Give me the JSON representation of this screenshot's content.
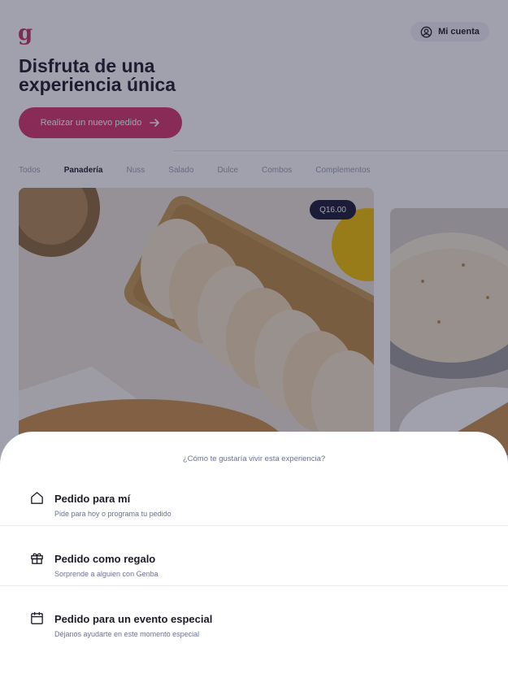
{
  "header": {
    "logo": "g",
    "account_label": "Mi cuenta"
  },
  "hero": {
    "title": "Disfruta de una experiencia única",
    "cta_label": "Realizar un nuevo pedido"
  },
  "tabs": [
    "Todos",
    "Panadería",
    "Nuss",
    "Salado",
    "Dulce",
    "Combos",
    "Complementos"
  ],
  "active_tab": "Panadería",
  "product": {
    "price": "Q16.00"
  },
  "sheet": {
    "title": "¿Cómo te gustaría vivir esta experiencia?",
    "options": [
      {
        "icon": "home-icon",
        "title": "Pedido para mí",
        "subtitle": "Pide para hoy o programa tu pedido"
      },
      {
        "icon": "gift-icon",
        "title": "Pedido como regalo",
        "subtitle": "Sorprende a alguien con Genba"
      },
      {
        "icon": "calendar-icon",
        "title": "Pedido para un evento especial",
        "subtitle": "Déjanos ayudarte en este momento especial"
      }
    ]
  },
  "colors": {
    "brand": "#d4356c",
    "dark": "#1c1b29",
    "badge": "#171a36"
  }
}
